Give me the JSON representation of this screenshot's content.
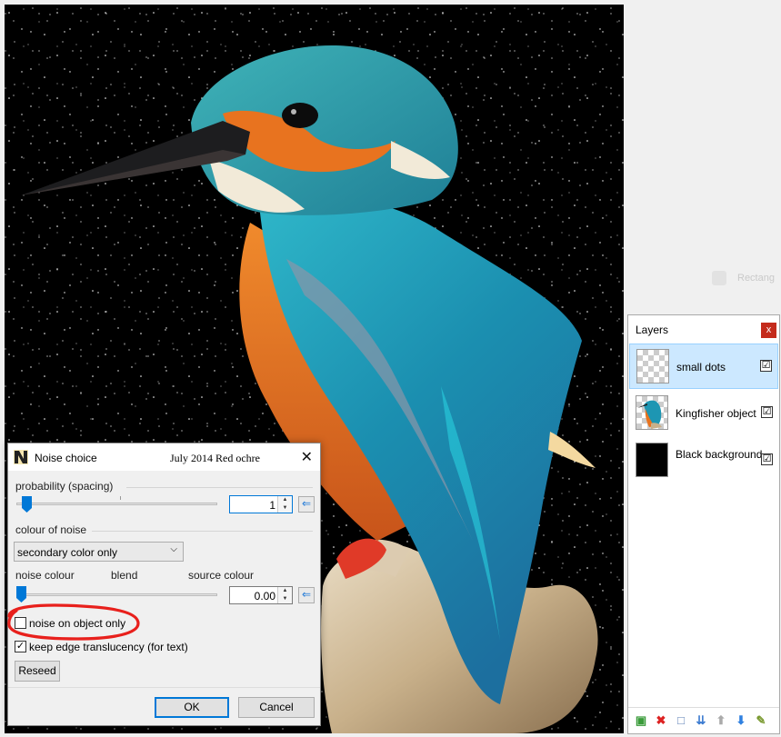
{
  "layers_panel": {
    "title": "Layers",
    "close_label": "x",
    "items": [
      {
        "name": "small dots",
        "visible": true,
        "selected": true,
        "check": "☑"
      },
      {
        "name": "Kingfisher object",
        "visible": true,
        "selected": false,
        "check": "☑"
      },
      {
        "name": "Black background",
        "visible": true,
        "selected": false,
        "check": "☑"
      }
    ],
    "tool_icons": [
      "add-layer-icon",
      "delete-layer-icon",
      "duplicate-layer-icon",
      "merge-down-icon",
      "move-up-icon",
      "move-down-icon",
      "properties-icon"
    ]
  },
  "dialog": {
    "title": "Noise choice",
    "subtitle": "July 2014 Red ochre",
    "close_glyph": "✕",
    "probability": {
      "label": "probability (spacing)",
      "value": "1",
      "slider_fraction": 0.03
    },
    "colour_of_noise": {
      "label": "colour of noise",
      "selected": "secondary color only"
    },
    "blend": {
      "left_label": "noise colour",
      "mid_label": "blend",
      "right_label": "source colour",
      "value": "0.00",
      "slider_fraction": 0.0
    },
    "noise_on_object_only": {
      "label": "noise on object only",
      "checked": false
    },
    "keep_edge_translucency": {
      "label": "keep edge translucency (for text)",
      "checked": true,
      "check": "✓"
    },
    "reseed_label": "Reseed",
    "ok_label": "OK",
    "cancel_label": "Cancel",
    "reset_glyph": "⇐"
  },
  "colors": {
    "accent": "#0078d7",
    "annotation": "#e8201c",
    "selection": "#cce8ff",
    "close_red": "#c42b1c"
  }
}
